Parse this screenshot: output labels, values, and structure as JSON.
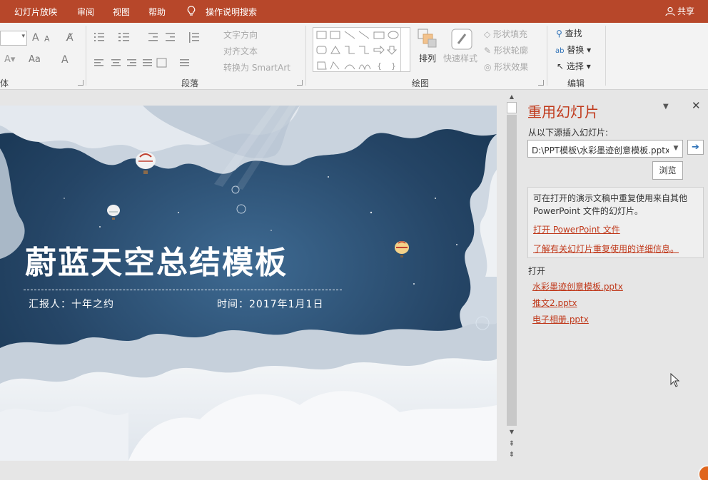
{
  "tabs": [
    "幻灯片放映",
    "审阅",
    "视图",
    "帮助"
  ],
  "search_label": "操作说明搜索",
  "share_label": "共享",
  "ribbon": {
    "font_group_label": "体",
    "paragraph_group_label": "段落",
    "drawing_group_label": "绘图",
    "editing_group_label": "编辑",
    "text_direction_label": "文字方向",
    "align_text_label": "对齐文本",
    "convert_smartart_label": "转换为 SmartArt",
    "arrange_label": "排列",
    "quick_styles_label": "快速样式",
    "shape_fill_label": "形状填充",
    "shape_outline_label": "形状轮廓",
    "shape_effects_label": "形状效果",
    "find_label": "查找",
    "replace_label": "替换",
    "select_label": "选择",
    "font_grow_label": "A",
    "font_shrink_label": "A",
    "change_case_label": "Aa",
    "font_color_label": "A"
  },
  "slide": {
    "title": "蔚蓝天空总结模板",
    "reporter": "汇报人：十年之约",
    "time": "时间：2017年1月1日"
  },
  "pane": {
    "title": "重用幻灯片",
    "insert_from_label": "从以下源插入幻灯片:",
    "source_value": "D:\\PPT模板\\水彩墨迹创意模板.pptx",
    "browse_label": "浏览",
    "info_text": "可在打开的演示文稿中重复使用来自其他 PowerPoint 文件的幻灯片。",
    "open_pp_link": "打开 PowerPoint 文件",
    "learn_more_link": "了解有关幻灯片重复使用的详细信息。",
    "open_heading": "打开",
    "recent_files": [
      "水彩墨迹创意模板.pptx",
      "推文2.pptx",
      "电子相册.pptx"
    ]
  },
  "colors": {
    "accent": "#b7472a",
    "link": "#c0391b",
    "slide_sky": "#2b4c6d"
  }
}
